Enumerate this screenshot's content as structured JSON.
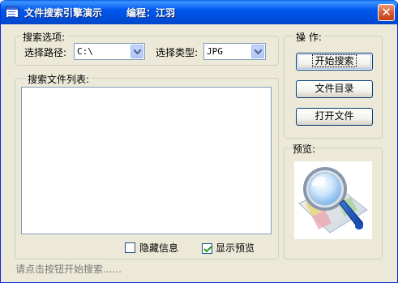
{
  "window": {
    "title": "文件搜索引擎演示",
    "author": "编程：江羽",
    "close_symbol": "✕"
  },
  "search_options": {
    "group_label": "搜索选项:",
    "path_label": "选择路径:",
    "path_value": "C:\\",
    "type_label": "选择类型:",
    "type_value": "JPG"
  },
  "file_list": {
    "group_label": "搜索文件列表:"
  },
  "operations": {
    "group_label": "操 作:",
    "start_search": "开始搜索",
    "file_directory": "文件目录",
    "open_file": "打开文件"
  },
  "preview": {
    "group_label": "预览:",
    "icon": "magnifier-over-document-icon"
  },
  "options": {
    "hide_info_label": "隐藏信息",
    "hide_info_checked": false,
    "show_preview_label": "显示预览",
    "show_preview_checked": true
  },
  "status": {
    "text": "请点击按钮开始搜索......"
  },
  "colors": {
    "titlebar": "#0054E3",
    "window_bg": "#ECE9D8",
    "close_button": "#D65C35",
    "status_text": "#7A7A7A"
  }
}
